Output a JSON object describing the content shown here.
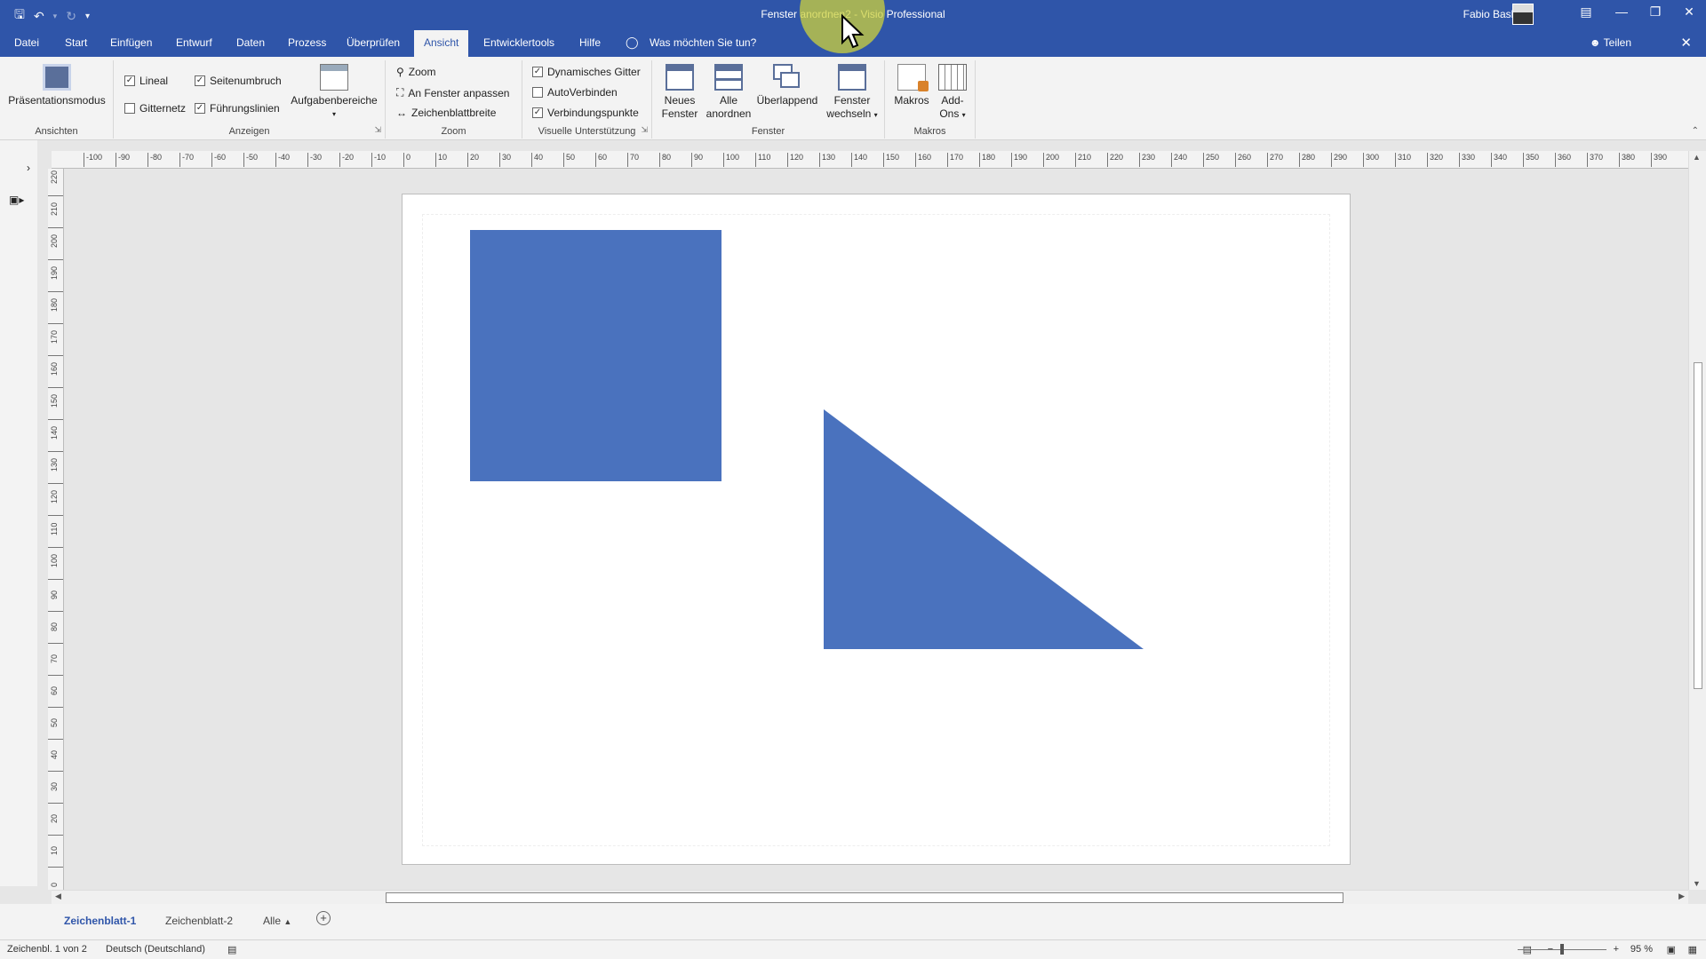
{
  "window": {
    "title": "Fenster anordnen2  -  Visio Professional",
    "user": "Fabio Basler"
  },
  "qat": {
    "save_icon": "save-icon",
    "undo_icon": "undo-icon",
    "redo_icon": "redo-icon"
  },
  "menu": {
    "tabs": [
      "Datei",
      "Start",
      "Einfügen",
      "Entwurf",
      "Daten",
      "Prozess",
      "Überprüfen",
      "Ansicht",
      "Entwicklertools",
      "Hilfe"
    ],
    "active_tab": "Ansicht",
    "tell_me": "Was möchten Sie tun?",
    "share": "Teilen"
  },
  "ribbon": {
    "ansichten": {
      "label": "Ansichten",
      "presentation": "Präsentationsmodus"
    },
    "anzeigen": {
      "label": "Anzeigen",
      "lineal": "Lineal",
      "gitternetz": "Gitternetz",
      "seitenumbruch": "Seitenumbruch",
      "fuehrungslinien": "Führungslinien",
      "aufgabenbereiche": "Aufgabenbereiche",
      "lineal_checked": true,
      "gitternetz_checked": false,
      "seitenumbruch_checked": true,
      "fuehrungslinien_checked": true
    },
    "zoom": {
      "label": "Zoom",
      "zoom": "Zoom",
      "fit": "An Fenster anpassen",
      "page_width": "Zeichenblattbreite"
    },
    "visual": {
      "label": "Visuelle Unterstützung",
      "dyn_grid": "Dynamisches Gitter",
      "autoconnect": "AutoVerbinden",
      "connection_points": "Verbindungspunkte",
      "dyn_grid_checked": true,
      "autoconnect_checked": false,
      "connection_points_checked": true
    },
    "fenster": {
      "label": "Fenster",
      "new_window_1": "Neues",
      "new_window_2": "Fenster",
      "arrange_1": "Alle",
      "arrange_2": "anordnen",
      "cascade": "Überlappend",
      "switch_1": "Fenster",
      "switch_2": "wechseln"
    },
    "makros": {
      "label": "Makros",
      "macros": "Makros",
      "addons_1": "Add-",
      "addons_2": "Ons"
    }
  },
  "rulers": {
    "horizontal": [
      "-100",
      "-90",
      "-80",
      "-70",
      "-60",
      "-50",
      "-40",
      "-30",
      "-20",
      "-10",
      "0",
      "10",
      "20",
      "30",
      "40",
      "50",
      "60",
      "70",
      "80",
      "90",
      "100",
      "110",
      "120",
      "130",
      "140",
      "150",
      "160",
      "170",
      "180",
      "190",
      "200",
      "210",
      "220",
      "230",
      "240",
      "250",
      "260",
      "270",
      "280",
      "290",
      "300",
      "310",
      "320",
      "330",
      "340",
      "350",
      "360",
      "370",
      "380",
      "390"
    ],
    "vertical": [
      "220",
      "210",
      "200",
      "190",
      "180",
      "170",
      "160",
      "150",
      "140",
      "130",
      "120",
      "110",
      "100",
      "90",
      "80",
      "70",
      "60",
      "50",
      "40",
      "30",
      "20",
      "10",
      "0"
    ]
  },
  "shapes": {
    "color": "#4a72be"
  },
  "sheets": {
    "tabs": [
      "Zeichenblatt-1",
      "Zeichenblatt-2",
      "Alle"
    ],
    "active": "Zeichenblatt-1"
  },
  "status": {
    "page": "Zeichenbl. 1 von 2",
    "language": "Deutsch (Deutschland)",
    "zoom": "95 %"
  },
  "colors": {
    "accent": "#2f55a9",
    "ribbon_bg": "#f3f3f3"
  }
}
